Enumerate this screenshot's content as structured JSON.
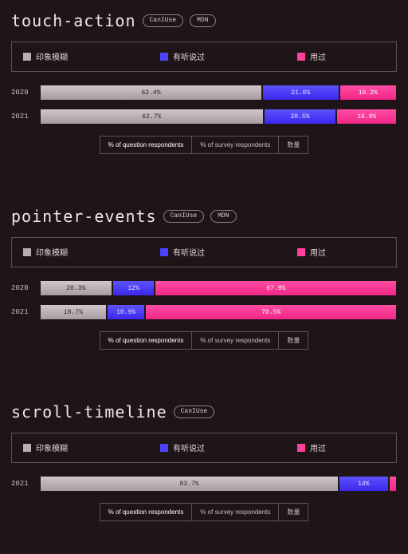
{
  "legend": {
    "never_heard": "印象模糊",
    "heard": "有听说过",
    "used": "用过"
  },
  "tabs": {
    "question": "% of question respondents",
    "survey": "% of survey respondents",
    "count": "数量"
  },
  "links": {
    "caniuse": "CanIUse",
    "mdn": "MDN"
  },
  "sections": [
    {
      "title": "touch-action",
      "links": [
        "caniuse",
        "mdn"
      ],
      "rows": [
        {
          "year": "2020",
          "gray": 62.4,
          "blue": 21.6,
          "pink": 16.2
        },
        {
          "year": "2021",
          "gray": 62.7,
          "blue": 20.5,
          "pink": 16.9
        }
      ]
    },
    {
      "title": "pointer-events",
      "links": [
        "caniuse",
        "mdn"
      ],
      "rows": [
        {
          "year": "2020",
          "gray": 20.3,
          "blue": 12.0,
          "pink": 67.9
        },
        {
          "year": "2021",
          "gray": 18.7,
          "blue": 10.9,
          "pink": 70.5
        }
      ]
    },
    {
      "title": "scroll-timeline",
      "links": [
        "caniuse"
      ],
      "rows": [
        {
          "year": "2021",
          "gray": 83.7,
          "blue": 14.0,
          "pink": 2.3
        }
      ]
    }
  ],
  "chart_data": [
    {
      "type": "bar",
      "title": "touch-action",
      "categories": [
        "2020",
        "2021"
      ],
      "series": [
        {
          "name": "印象模糊",
          "values": [
            62.4,
            62.7
          ]
        },
        {
          "name": "有听说过",
          "values": [
            21.6,
            20.5
          ]
        },
        {
          "name": "用过",
          "values": [
            16.2,
            16.9
          ]
        }
      ],
      "xlabel": "",
      "ylabel": "% of question respondents",
      "ylim": [
        0,
        100
      ]
    },
    {
      "type": "bar",
      "title": "pointer-events",
      "categories": [
        "2020",
        "2021"
      ],
      "series": [
        {
          "name": "印象模糊",
          "values": [
            20.3,
            18.7
          ]
        },
        {
          "name": "有听说过",
          "values": [
            12.0,
            10.9
          ]
        },
        {
          "name": "用过",
          "values": [
            67.9,
            70.5
          ]
        }
      ],
      "xlabel": "",
      "ylabel": "% of question respondents",
      "ylim": [
        0,
        100
      ]
    },
    {
      "type": "bar",
      "title": "scroll-timeline",
      "categories": [
        "2021"
      ],
      "series": [
        {
          "name": "印象模糊",
          "values": [
            83.7
          ]
        },
        {
          "name": "有听说过",
          "values": [
            14.0
          ]
        },
        {
          "name": "用过",
          "values": [
            2.3
          ]
        }
      ],
      "xlabel": "",
      "ylabel": "% of question respondents",
      "ylim": [
        0,
        100
      ]
    }
  ]
}
